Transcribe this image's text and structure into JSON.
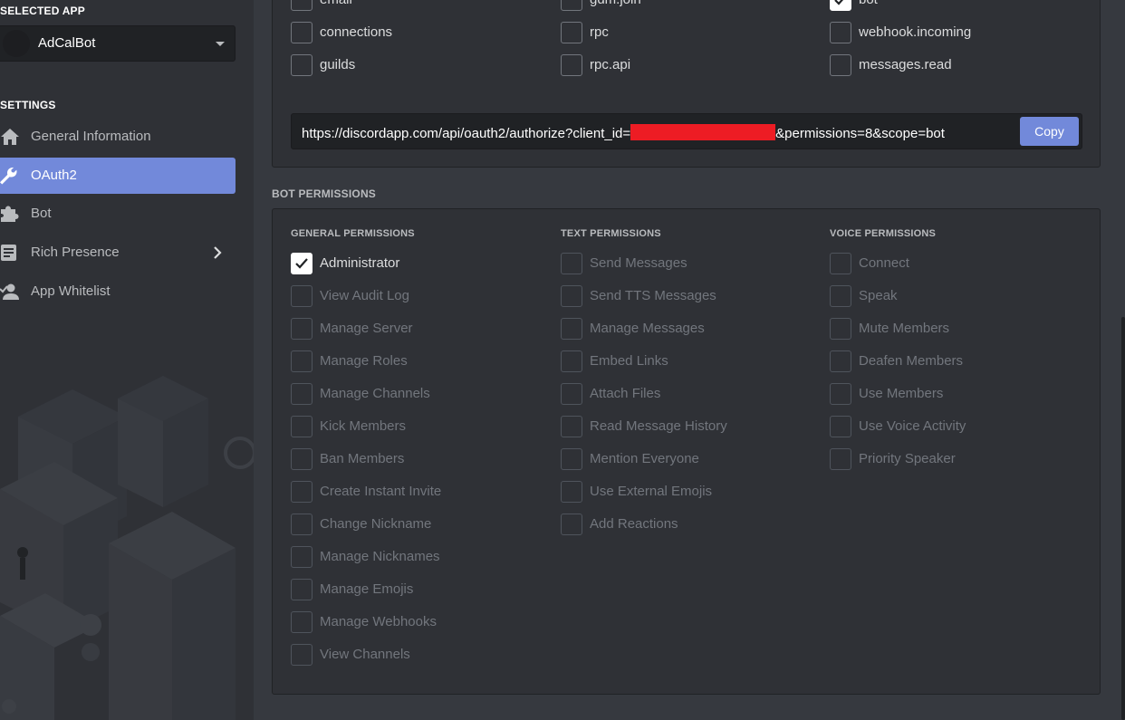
{
  "sidebar": {
    "selected_app_label": "SELECTED APP",
    "app_name": "AdCalBot",
    "settings_label": "SETTINGS",
    "items": [
      {
        "label": "General Information",
        "icon": "home-icon"
      },
      {
        "label": "OAuth2",
        "icon": "wrench-icon",
        "active": true
      },
      {
        "label": "Bot",
        "icon": "puzzle-icon"
      },
      {
        "label": "Rich Presence",
        "icon": "document-icon",
        "has_chevron": true
      },
      {
        "label": "App Whitelist",
        "icon": "user-add-icon"
      }
    ]
  },
  "scopes": {
    "columns": [
      [
        {
          "label": "email",
          "checked": false
        },
        {
          "label": "connections",
          "checked": false
        },
        {
          "label": "guilds",
          "checked": false
        }
      ],
      [
        {
          "label": "gdm.join",
          "checked": false
        },
        {
          "label": "rpc",
          "checked": false
        },
        {
          "label": "rpc.api",
          "checked": false
        }
      ],
      [
        {
          "label": "bot",
          "checked": true
        },
        {
          "label": "webhook.incoming",
          "checked": false
        },
        {
          "label": "messages.read",
          "checked": false
        }
      ]
    ],
    "url_prefix": "https://discordapp.com/api/oauth2/authorize?client_id=",
    "url_suffix": "&permissions=8&scope=bot",
    "copy_label": "Copy"
  },
  "bot_permissions": {
    "title": "BOT PERMISSIONS",
    "general": {
      "title": "GENERAL PERMISSIONS",
      "items": [
        {
          "label": "Administrator",
          "checked": true
        },
        {
          "label": "View Audit Log",
          "checked": false
        },
        {
          "label": "Manage Server",
          "checked": false
        },
        {
          "label": "Manage Roles",
          "checked": false
        },
        {
          "label": "Manage Channels",
          "checked": false
        },
        {
          "label": "Kick Members",
          "checked": false
        },
        {
          "label": "Ban Members",
          "checked": false
        },
        {
          "label": "Create Instant Invite",
          "checked": false
        },
        {
          "label": "Change Nickname",
          "checked": false
        },
        {
          "label": "Manage Nicknames",
          "checked": false
        },
        {
          "label": "Manage Emojis",
          "checked": false
        },
        {
          "label": "Manage Webhooks",
          "checked": false
        },
        {
          "label": "View Channels",
          "checked": false
        }
      ]
    },
    "text": {
      "title": "TEXT PERMISSIONS",
      "items": [
        {
          "label": "Send Messages",
          "checked": false
        },
        {
          "label": "Send TTS Messages",
          "checked": false
        },
        {
          "label": "Manage Messages",
          "checked": false
        },
        {
          "label": "Embed Links",
          "checked": false
        },
        {
          "label": "Attach Files",
          "checked": false
        },
        {
          "label": "Read Message History",
          "checked": false
        },
        {
          "label": "Mention Everyone",
          "checked": false
        },
        {
          "label": "Use External Emojis",
          "checked": false
        },
        {
          "label": "Add Reactions",
          "checked": false
        }
      ]
    },
    "voice": {
      "title": "VOICE PERMISSIONS",
      "items": [
        {
          "label": "Connect",
          "checked": false
        },
        {
          "label": "Speak",
          "checked": false
        },
        {
          "label": "Mute Members",
          "checked": false
        },
        {
          "label": "Deafen Members",
          "checked": false
        },
        {
          "label": "Use Members",
          "checked": false
        },
        {
          "label": "Use Voice Activity",
          "checked": false
        },
        {
          "label": "Priority Speaker",
          "checked": false
        }
      ]
    }
  },
  "colors": {
    "accent": "#7289da",
    "background": "#36393f",
    "panel": "#2f3136",
    "redaction": "#ed1c24"
  }
}
